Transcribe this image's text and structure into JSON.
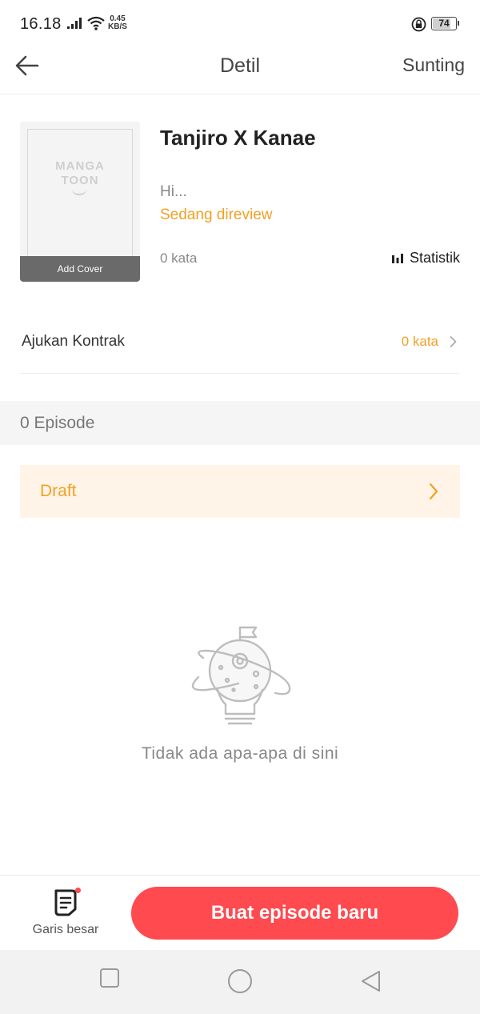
{
  "status_bar": {
    "time": "16.18",
    "net_speed_value": "0.45",
    "net_speed_unit": "KB/S",
    "battery_level": "74",
    "battery_fraction": 0.74
  },
  "nav": {
    "title": "Detil",
    "action": "Sunting"
  },
  "book": {
    "cover_logo_line1": "MANGA",
    "cover_logo_line2": "TOON",
    "cover_button": "Add Cover",
    "title": "Tanjiro X Kanae",
    "description": "Hi...",
    "status": "Sedang direview",
    "word_count": "0 kata",
    "stats_label": "Statistik"
  },
  "contract": {
    "label": "Ajukan Kontrak",
    "value": "0 kata"
  },
  "episodes": {
    "count_label": "0 Episode",
    "draft_label": "Draft"
  },
  "empty_state": {
    "text": "Tidak ada apa-apa di sini"
  },
  "bottom": {
    "outline_label": "Garis besar",
    "create_button": "Buat episode baru"
  },
  "colors": {
    "accent_orange": "#f2a024",
    "accent_red": "#ff4a4f",
    "draft_background": "#fff4e7"
  },
  "icons": {
    "back": "arrow-left-icon",
    "stats": "bar-chart-icon",
    "chevron": "chevron-right-icon",
    "empty": "planet-lightbulb-icon",
    "outline": "document-icon"
  }
}
